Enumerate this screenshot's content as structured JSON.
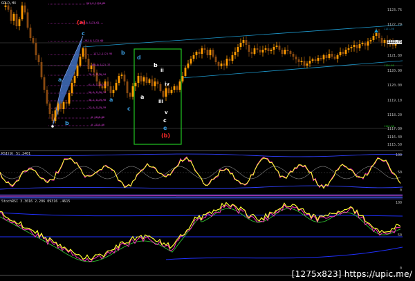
{
  "chart": {
    "symbol_label": "GOLD,H4",
    "colors": {
      "background": "#000000",
      "bull_candle": "#ff9a00",
      "bear_candle": "#8a4a10",
      "trend_line": "#1e9bd0",
      "fib_level": "#d030d0",
      "harmonic_fill": "#4a7fd8",
      "highlight_box": "#22c422",
      "wave_blue": "#3a9bdc",
      "wave_white": "#ffffff",
      "wave_red": "#ff2a2a",
      "wave_pink": "#e040a0"
    },
    "price_axis": [
      "1123.76",
      "1122.70",
      "1121.80",
      "1120.90",
      "1120.00",
      "1119.10",
      "1118.20",
      "1117.30",
      "1116.40",
      "1115.50"
    ],
    "current_price": "1122.75",
    "level_labels": [
      "1121.50",
      "1120.60",
      "1119.30",
      "1116.00"
    ],
    "fib_labels": [
      "261.8 1124.80",
      "200.0 1123.62",
      "161.8 1122.60",
      "127.2 1121.95",
      "100.0 1121.37",
      "78.6 1120.94",
      "61.8 1120.52",
      "50.0 1120.28",
      "38.2 1119.98",
      "23.6 1119.59",
      "0 1118.80",
      "0 1116.60"
    ],
    "wave_labels": {
      "a_bracket": "(a)",
      "c_top": "c",
      "a_mid": "a",
      "b_low": "b",
      "b_left": "b",
      "a_low": "a",
      "c_low": "c",
      "d": "d",
      "a_box": "a",
      "b_box": "b",
      "ii": "ii",
      "iv": "iv",
      "iii": "iii",
      "v": "v",
      "c_box": "c",
      "e": "e",
      "b_bracket": "(b)"
    }
  },
  "rsi_pane": {
    "label": "RSI(9) 51.2401",
    "axis": [
      "100",
      "50",
      "0"
    ]
  },
  "stoch_pane": {
    "label": "StochRSI 3.3016 2.206 09316 .4615",
    "axis": [
      "100",
      "50",
      "0"
    ]
  },
  "watermark": "[1275x823] https://upic.me/"
}
